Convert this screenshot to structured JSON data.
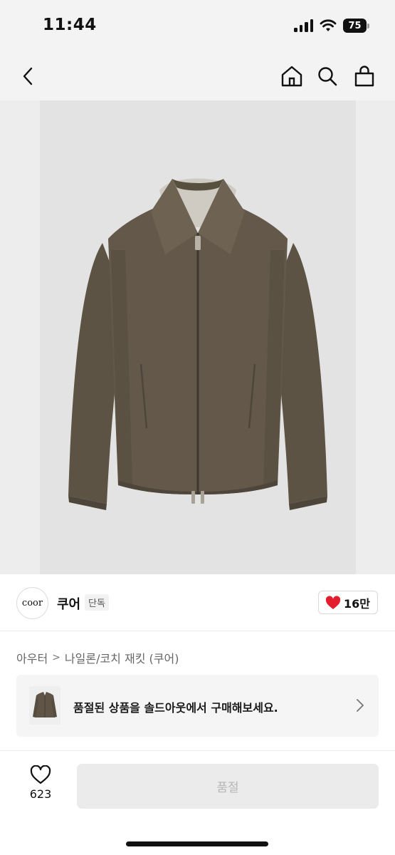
{
  "status_bar": {
    "time": "11:44",
    "battery": "75",
    "icons": [
      "signal-icon",
      "wifi-icon",
      "battery-icon"
    ]
  },
  "nav": {
    "icons": [
      "back-icon",
      "home-icon",
      "search-icon",
      "shopping-bag-icon"
    ]
  },
  "product": {
    "image": "olive-brown-zip-up-jacket-photo"
  },
  "brand": {
    "logo_text": "coor",
    "name": "쿠어",
    "tag": "단독",
    "likes": "16만"
  },
  "breadcrumb": {
    "category": "아우터",
    "separator": ">",
    "subcategory": "나일론/코치 재킷 (쿠어)"
  },
  "soldout_banner": {
    "text": "품절된 상품을 솔드아웃에서 구매해보세요."
  },
  "bottom_bar": {
    "wish_count": "623",
    "buy_label": "품절"
  },
  "colors": {
    "heart_red": "#e31d2b",
    "jacket_olive": "#5f5446",
    "disabled_button": "#ebebeb",
    "disabled_text": "#b6b6b6"
  }
}
